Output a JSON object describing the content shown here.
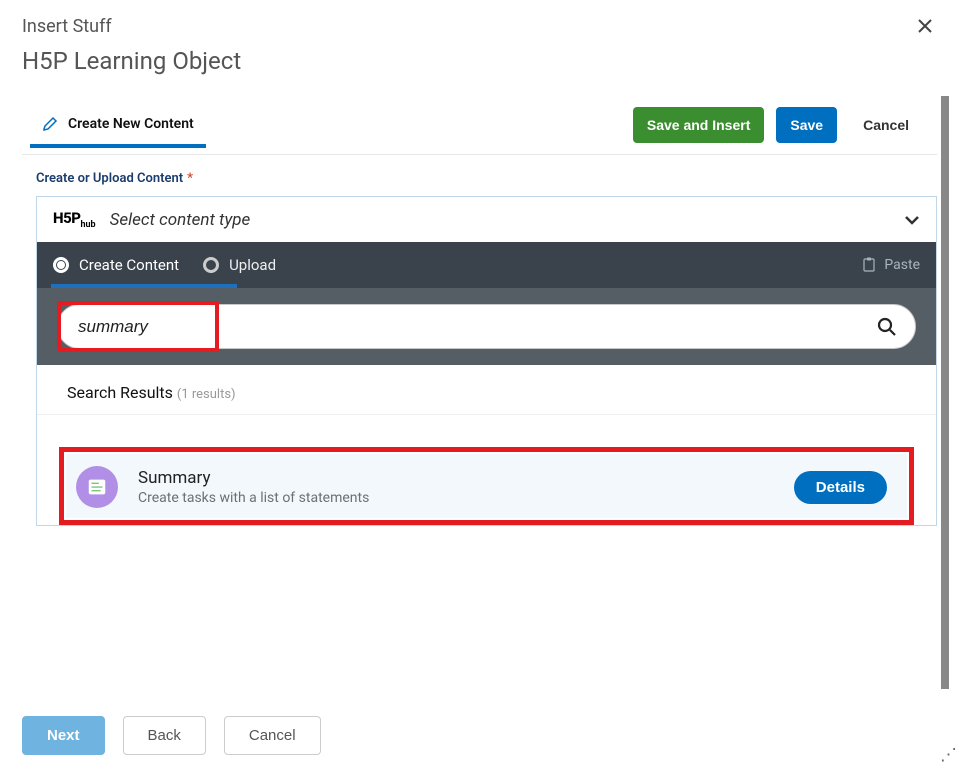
{
  "header": {
    "insert_stuff": "Insert Stuff",
    "page_title": "H5P Learning Object"
  },
  "editor": {
    "tab_label": "Create New Content",
    "save_insert": "Save and Insert",
    "save": "Save",
    "cancel": "Cancel"
  },
  "field": {
    "label": "Create or Upload Content"
  },
  "h5p": {
    "logo_main": "H5P",
    "logo_sub": "hub",
    "select_text": "Select content type",
    "tab_create": "Create Content",
    "tab_upload": "Upload",
    "paste": "Paste"
  },
  "search": {
    "value": "summary"
  },
  "results": {
    "header": "Search Results",
    "count": "(1 results)",
    "items": [
      {
        "title": "Summary",
        "desc": "Create tasks with a list of statements",
        "details": "Details"
      }
    ]
  },
  "footer": {
    "next": "Next",
    "back": "Back",
    "cancel": "Cancel"
  }
}
